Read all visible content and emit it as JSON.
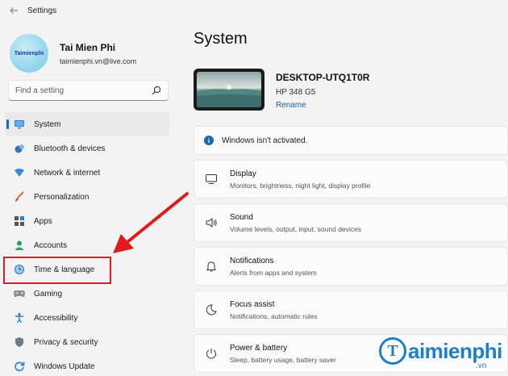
{
  "window": {
    "title": "Settings"
  },
  "profile": {
    "name": "Tai Mien Phi",
    "email": "taimienphi.vn@live.com",
    "avatar_label": "Taimienphi"
  },
  "search": {
    "placeholder": "Find a setting"
  },
  "sidebar": {
    "items": [
      {
        "label": "System",
        "icon": "monitor-icon",
        "active": true
      },
      {
        "label": "Bluetooth & devices",
        "icon": "bluetooth-icon"
      },
      {
        "label": "Network & internet",
        "icon": "wifi-icon"
      },
      {
        "label": "Personalization",
        "icon": "brush-icon"
      },
      {
        "label": "Apps",
        "icon": "apps-icon"
      },
      {
        "label": "Accounts",
        "icon": "person-icon"
      },
      {
        "label": "Time & language",
        "icon": "globe-clock-icon"
      },
      {
        "label": "Gaming",
        "icon": "gamepad-icon"
      },
      {
        "label": "Accessibility",
        "icon": "accessibility-icon"
      },
      {
        "label": "Privacy & security",
        "icon": "shield-icon"
      },
      {
        "label": "Windows Update",
        "icon": "update-icon"
      }
    ]
  },
  "main": {
    "title": "System",
    "device": {
      "name": "DESKTOP-UTQ1T0R",
      "model": "HP 348 G5",
      "rename_label": "Rename"
    },
    "activation_notice": "Windows isn't activated.",
    "settings": [
      {
        "title": "Display",
        "description": "Monitors, brightness, night light, display profile",
        "icon": "display-icon"
      },
      {
        "title": "Sound",
        "description": "Volume levels, output, input, sound devices",
        "icon": "speaker-icon"
      },
      {
        "title": "Notifications",
        "description": "Alerts from apps and system",
        "icon": "bell-icon"
      },
      {
        "title": "Focus assist",
        "description": "Notifications, automatic rules",
        "icon": "moon-icon"
      },
      {
        "title": "Power & battery",
        "description": "Sleep, battery usage, battery saver",
        "icon": "power-icon"
      }
    ]
  },
  "colors": {
    "accent": "#0a6dbf",
    "highlight": "#e01b1b",
    "watermark": "#1b7fc9"
  },
  "watermark": {
    "mark": "T",
    "text": "aimienphi",
    "suffix": ".vn"
  }
}
